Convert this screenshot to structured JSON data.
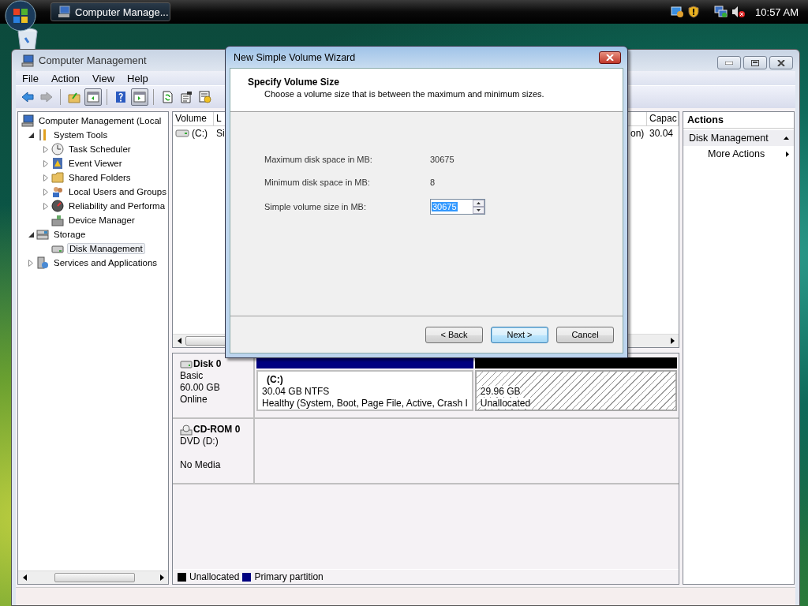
{
  "taskbar": {
    "button": "Computer Manage...",
    "clock": "10:57 AM"
  },
  "window": {
    "title": "Computer Management"
  },
  "menu": [
    "File",
    "Action",
    "View",
    "Help"
  ],
  "toolbar": [
    {
      "kind": "back",
      "disabled": false,
      "pressed": false
    },
    {
      "kind": "forward",
      "disabled": true,
      "pressed": false
    },
    {
      "kind": "up",
      "disabled": false,
      "pressed": false
    },
    {
      "kind": "tree",
      "disabled": false,
      "pressed": true
    },
    {
      "kind": "help",
      "disabled": false,
      "pressed": false
    },
    {
      "kind": "pane",
      "disabled": false,
      "pressed": true
    },
    {
      "kind": "refresh",
      "disabled": false,
      "pressed": false
    },
    {
      "kind": "properties",
      "disabled": false,
      "pressed": false
    },
    {
      "kind": "settings",
      "disabled": false,
      "pressed": false
    }
  ],
  "tree": [
    {
      "label": "Computer Management (Local",
      "kind": "computer",
      "selected": false,
      "children": [
        {
          "label": "System Tools",
          "kind": "tools",
          "expanded": true,
          "selected": false,
          "children": [
            {
              "label": "Task Scheduler",
              "kind": "clock",
              "expanded": false,
              "selected": false
            },
            {
              "label": "Event Viewer",
              "kind": "log",
              "expanded": false,
              "selected": false
            },
            {
              "label": "Shared Folders",
              "kind": "folder",
              "expanded": false,
              "selected": false
            },
            {
              "label": "Local Users and Groups",
              "kind": "users",
              "expanded": false,
              "selected": false
            },
            {
              "label": "Reliability and Performa",
              "kind": "gauge",
              "expanded": false,
              "selected": false
            },
            {
              "label": "Device Manager",
              "kind": "device",
              "selected": false
            }
          ]
        },
        {
          "label": "Storage",
          "kind": "storage",
          "expanded": true,
          "selected": false,
          "children": [
            {
              "label": "Disk Management",
              "kind": "disk",
              "selected": true
            }
          ]
        },
        {
          "label": "Services and Applications",
          "kind": "services",
          "expanded": false,
          "selected": false
        }
      ]
    }
  ],
  "volume_list": {
    "columns": [
      "Volume",
      "L",
      "",
      "Capac"
    ],
    "rows": [
      {
        "cells": [
          "(C:)",
          "Si",
          "on)",
          "30.04"
        ]
      }
    ]
  },
  "disks": [
    {
      "kind": "disk",
      "name": "Disk 0",
      "type": "Basic",
      "size": "60.00 GB",
      "status": "Online",
      "partitions": [
        {
          "kind": "primary",
          "color": "#000080",
          "title": "(C:)",
          "size": "30.04 GB NTFS",
          "status": "Healthy (System, Boot, Page File, Active, Crash I"
        },
        {
          "kind": "unallocated",
          "color": "#000000",
          "size": "29.96 GB",
          "status": "Unallocated"
        }
      ]
    },
    {
      "kind": "cdrom",
      "name": "CD-ROM 0",
      "type": "DVD (D:)",
      "status": "No Media"
    }
  ],
  "legend": [
    {
      "label": "Unallocated",
      "color": "#000000"
    },
    {
      "label": "Primary partition",
      "color": "#000080"
    }
  ],
  "actions": {
    "title": "Actions",
    "sections": [
      {
        "label": "Disk Management",
        "expanded": true,
        "items": [
          "More Actions"
        ]
      }
    ]
  },
  "wizard": {
    "title": "New Simple Volume Wizard",
    "heading": "Specify Volume Size",
    "subheading": "Choose a volume size that is between the maximum and minimum sizes.",
    "fields": [
      {
        "kind": "text",
        "label": "Maximum disk space in MB:",
        "value": "30675"
      },
      {
        "kind": "text",
        "label": "Minimum disk space in MB:",
        "value": "8"
      },
      {
        "kind": "spinner",
        "label": "Simple volume size in MB:",
        "value": "30675"
      }
    ],
    "buttons": [
      {
        "label": "< Back",
        "default": false
      },
      {
        "label": "Next >",
        "default": true
      },
      {
        "label": "Cancel",
        "default": false
      }
    ]
  }
}
